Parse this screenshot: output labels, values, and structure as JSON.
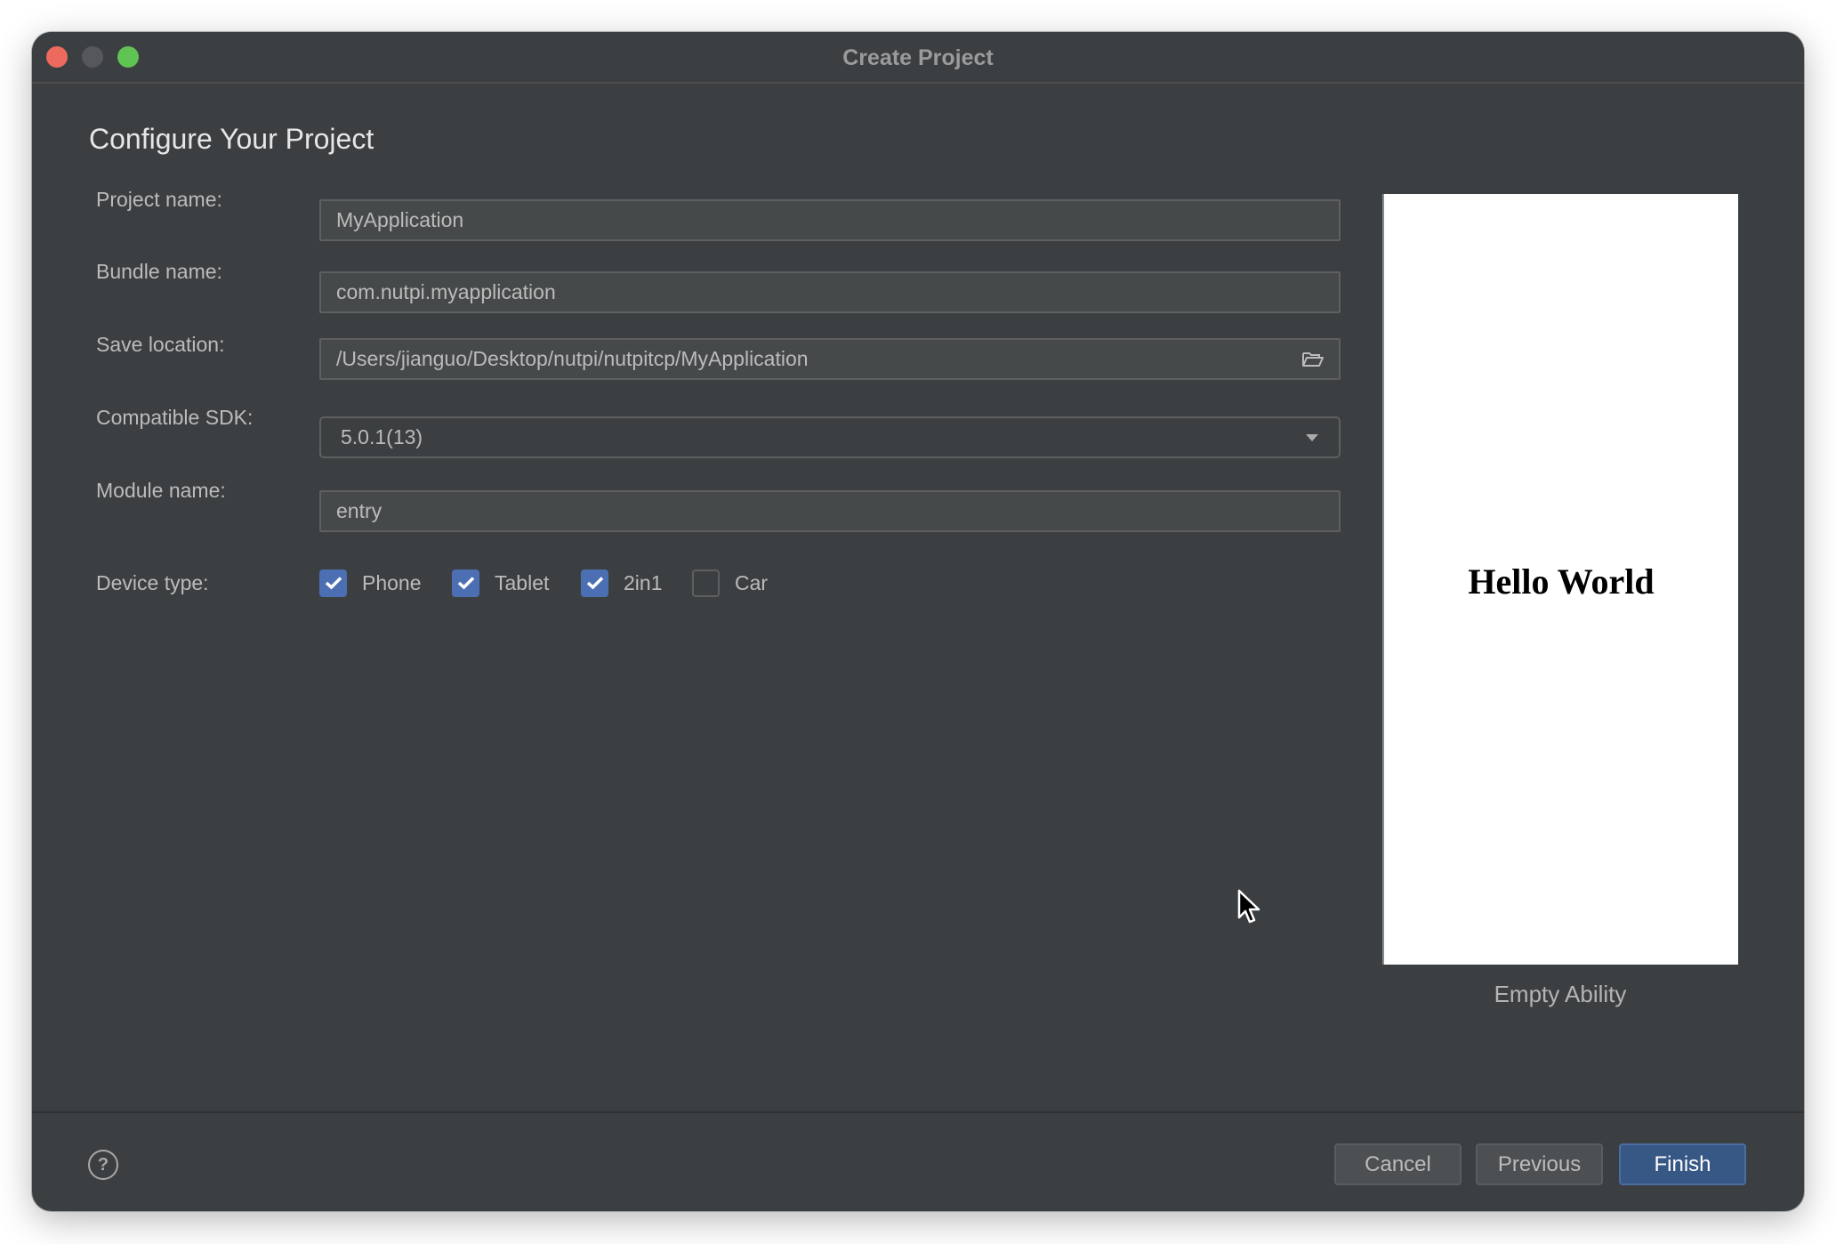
{
  "window": {
    "title": "Create Project",
    "controls": [
      "close",
      "minimize",
      "maximize"
    ]
  },
  "page": {
    "title": "Configure Your Project"
  },
  "form": {
    "project_name": {
      "label": "Project name:",
      "value": "MyApplication"
    },
    "bundle_name": {
      "label": "Bundle name:",
      "value": "com.nutpi.myapplication"
    },
    "save_location": {
      "label": "Save location:",
      "value": "/Users/jianguo/Desktop/nutpi/nutpitcp/MyApplication",
      "icon": "folder-open-icon"
    },
    "compatible_sdk": {
      "label": "Compatible SDK:",
      "value": "5.0.1(13)",
      "icon": "chevron-down-icon"
    },
    "module_name": {
      "label": "Module name:",
      "value": "entry"
    },
    "device_type": {
      "label": "Device type:",
      "options": [
        {
          "label": "Phone",
          "checked": true
        },
        {
          "label": "Tablet",
          "checked": true
        },
        {
          "label": "2in1",
          "checked": true
        },
        {
          "label": "Car",
          "checked": false
        }
      ]
    }
  },
  "preview": {
    "text": "Hello World",
    "template_name": "Empty Ability"
  },
  "footer": {
    "help_label": "?",
    "cancel_label": "Cancel",
    "previous_label": "Previous",
    "finish_label": "Finish"
  },
  "colors": {
    "window_bg": "#3c3f41",
    "field_bg": "#45494a",
    "checkbox_checked": "#4c6fb4",
    "primary_button": "#375785",
    "close": "#ed6a5e",
    "minimize": "#56575a",
    "maximize": "#5fc454"
  }
}
